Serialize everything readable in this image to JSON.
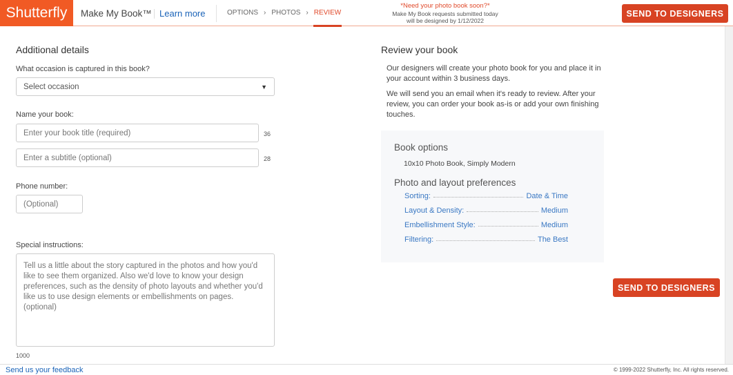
{
  "header": {
    "logo": "Shutterfly",
    "product": "Make My Book™",
    "learn_more": "Learn more",
    "steps": [
      "OPTIONS",
      "PHOTOS",
      "REVIEW"
    ],
    "step_sep": "›",
    "notice_title": "*Need your photo book soon?*",
    "notice_line1": "Make My Book requests submitted today",
    "notice_line2": "will be designed by 1/12/2022",
    "send_button": "SEND TO DESIGNERS"
  },
  "form": {
    "title": "Additional details",
    "occasion_label": "What occasion is captured in this book?",
    "occasion_value": "Select occasion",
    "name_label": "Name your book:",
    "title_placeholder": "Enter your book title (required)",
    "title_count": "36",
    "subtitle_placeholder": "Enter a subtitle (optional)",
    "subtitle_count": "28",
    "phone_label": "Phone number:",
    "phone_placeholder": "(Optional)",
    "instructions_label": "Special instructions:",
    "instructions_placeholder": "Tell us a little about the story captured in the photos and how you'd like to see them organized. Also we'd love to know your design preferences, such as the density of photo layouts and whether you'd like us to use design elements or embellishments on pages. (optional)",
    "instructions_count": "1000"
  },
  "review": {
    "title": "Review your book",
    "p1": "Our designers will create your photo book for you and place it in your account within 3 business days.",
    "p2": "We will send you an email when it's ready to review. After your review, you can order your book as-is or add your own finishing touches.",
    "book_options_title": "Book options",
    "book_options_value": "10x10 Photo Book, Simply Modern",
    "prefs_title": "Photo and layout preferences",
    "prefs": [
      {
        "label": "Sorting:",
        "value": "Date & Time"
      },
      {
        "label": "Layout & Density:",
        "value": "Medium"
      },
      {
        "label": "Embellishment Style:",
        "value": "Medium"
      },
      {
        "label": "Filtering:",
        "value": "The Best"
      }
    ],
    "send_button": "SEND TO DESIGNERS"
  },
  "footer": {
    "feedback": "Send us your feedback",
    "copyright": "© 1999-2022 Shutterfly, Inc. All rights reserved."
  }
}
